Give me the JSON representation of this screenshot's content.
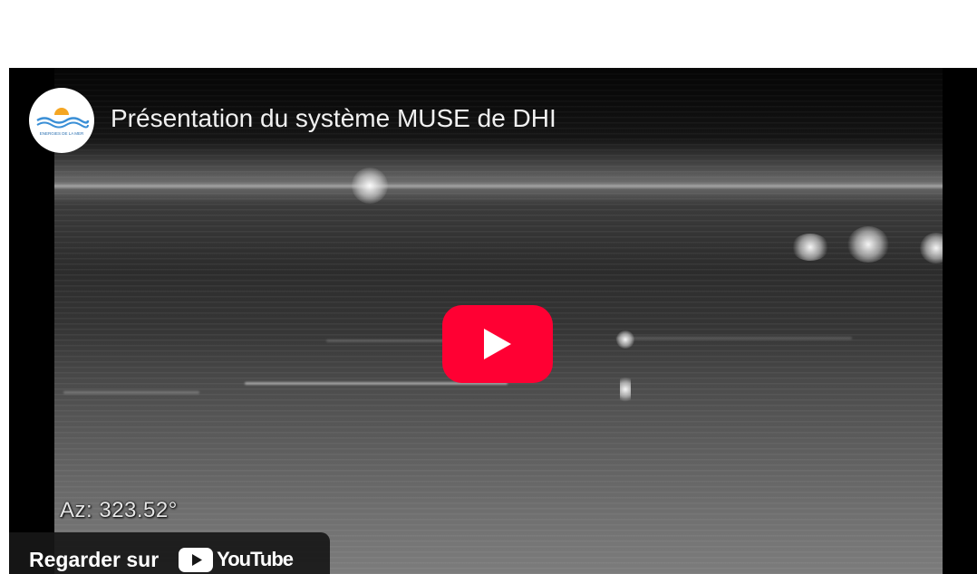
{
  "video": {
    "title": "Présentation du système MUSE de DHI",
    "overlay_text": "Az: 323.52°",
    "play_icon": "play-icon"
  },
  "channel": {
    "avatar_icon": "sun-waves-logo",
    "avatar_text": "ENERGIES DE LA MER"
  },
  "watch_on": {
    "label": "Regarder sur",
    "brand": "YouTube",
    "brand_icon": "youtube-play-icon"
  },
  "colors": {
    "play_button": "#ff0033",
    "title_text": "#f1f1f1",
    "watch_bar": "#171717"
  }
}
